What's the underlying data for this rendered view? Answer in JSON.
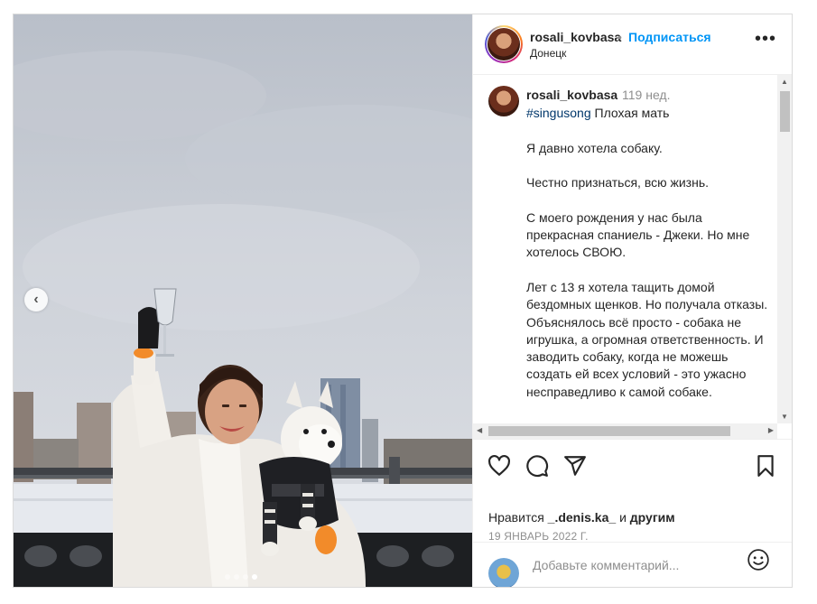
{
  "header": {
    "username": "rosali_kovbasa",
    "separator": "•",
    "follow_label": "Подписаться",
    "location": "Донецк",
    "more_label": "•••"
  },
  "caption": {
    "username": "rosali_kovbasa",
    "time_ago": "119 нед.",
    "hashtag": "#singusong",
    "title": "Плохая мать",
    "paragraphs": [
      "Я давно хотела собаку.",
      "Честно признаться, всю жизнь.",
      "С моего рождения у нас была прекрасная спаниель - Джеки. Но мне хотелось СВОЮ.",
      "Лет с 13 я хотела тащить домой бездомных щенков. Но получала отказы.",
      "Объяснялось всё просто - собака не игрушка, а огромная ответственность. И заводить собаку, когда не можешь создать ей всех условий - это ужасно несправедливо к самой собаке."
    ]
  },
  "media": {
    "prev_arrow": "‹",
    "carousel_count": 4,
    "carousel_active_index": 3
  },
  "actions": {
    "like_icon": "heart-icon",
    "comment_icon": "comment-icon",
    "share_icon": "paper-plane-icon",
    "save_icon": "bookmark-icon"
  },
  "likes": {
    "prefix": "Нравится",
    "user": "_.denis.ka_",
    "connector": "и",
    "others": "другим"
  },
  "post_date": "19 ЯНВАРЬ 2022 Г.",
  "comment": {
    "placeholder": "Добавьте комментарий...",
    "emoji_icon": "smiley-icon"
  },
  "colors": {
    "accent": "#0095f6",
    "text": "#262626",
    "muted": "#8e8e8e",
    "border": "#dbdbdb",
    "hashtag": "#00376b"
  }
}
